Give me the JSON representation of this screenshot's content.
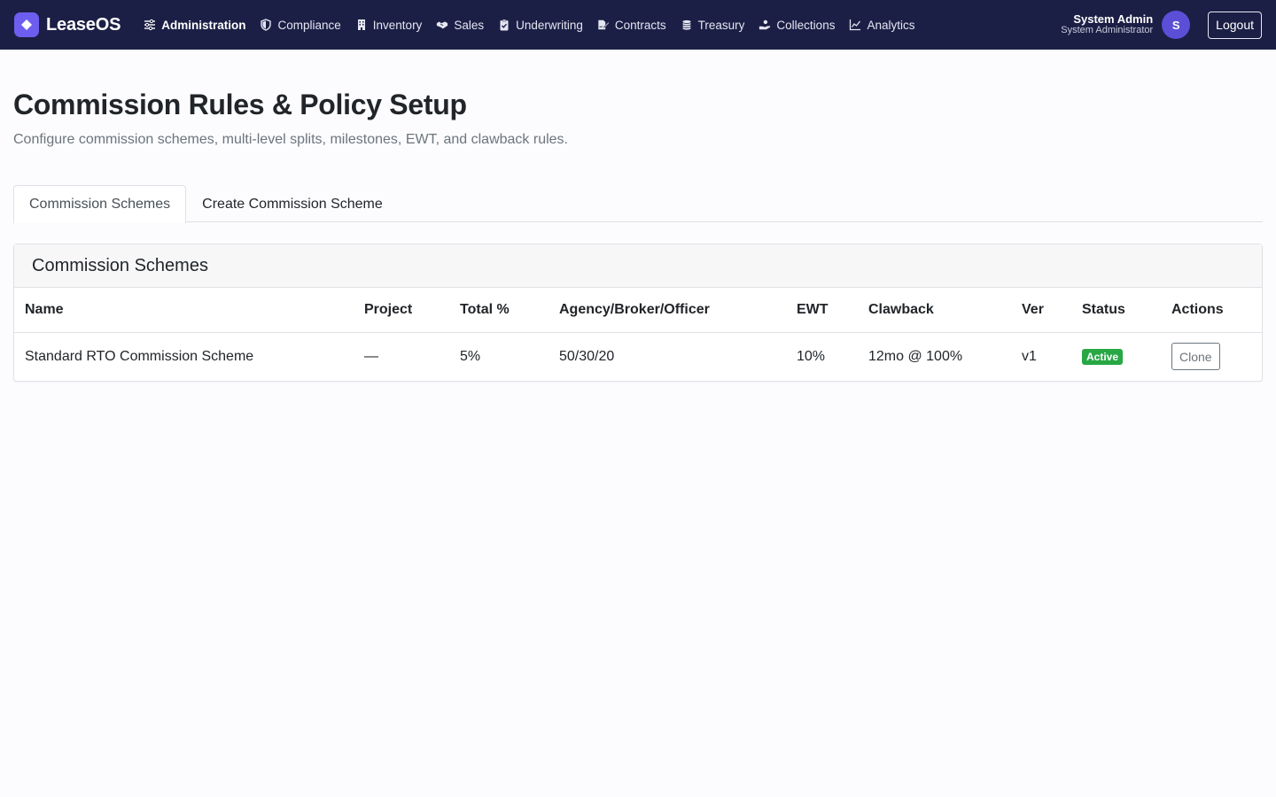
{
  "nav": {
    "brand": "LeaseOS",
    "items": [
      {
        "label": "Administration",
        "icon": "sliders-icon",
        "active": true
      },
      {
        "label": "Compliance",
        "icon": "shield-icon"
      },
      {
        "label": "Inventory",
        "icon": "building-icon"
      },
      {
        "label": "Sales",
        "icon": "handshake-icon"
      },
      {
        "label": "Underwriting",
        "icon": "clipboard-check-icon"
      },
      {
        "label": "Contracts",
        "icon": "file-signature-icon"
      },
      {
        "label": "Treasury",
        "icon": "coins-icon"
      },
      {
        "label": "Collections",
        "icon": "hand-coin-icon"
      },
      {
        "label": "Analytics",
        "icon": "line-chart-icon"
      }
    ],
    "user": {
      "name": "System Admin",
      "role": "System Administrator",
      "initial": "S"
    },
    "logout_label": "Logout"
  },
  "page": {
    "title": "Commission Rules & Policy Setup",
    "subtitle": "Configure commission schemes, multi-level splits, milestones, EWT, and clawback rules."
  },
  "tabs": [
    {
      "label": "Commission Schemes",
      "active": true
    },
    {
      "label": "Create Commission Scheme",
      "active": false
    }
  ],
  "card": {
    "title": "Commission Schemes",
    "columns": [
      "Name",
      "Project",
      "Total %",
      "Agency/Broker/Officer",
      "EWT",
      "Clawback",
      "Ver",
      "Status",
      "Actions"
    ],
    "rows": [
      {
        "name": "Standard RTO Commission Scheme",
        "project": "—",
        "total": "5%",
        "split": "50/30/20",
        "ewt": "10%",
        "clawback": "12mo @ 100%",
        "ver": "v1",
        "status": "Active",
        "action": "Clone"
      }
    ]
  },
  "colors": {
    "navbar": "#1c1f45",
    "accent": "#6d5ef0",
    "status_active": "#28a745"
  }
}
